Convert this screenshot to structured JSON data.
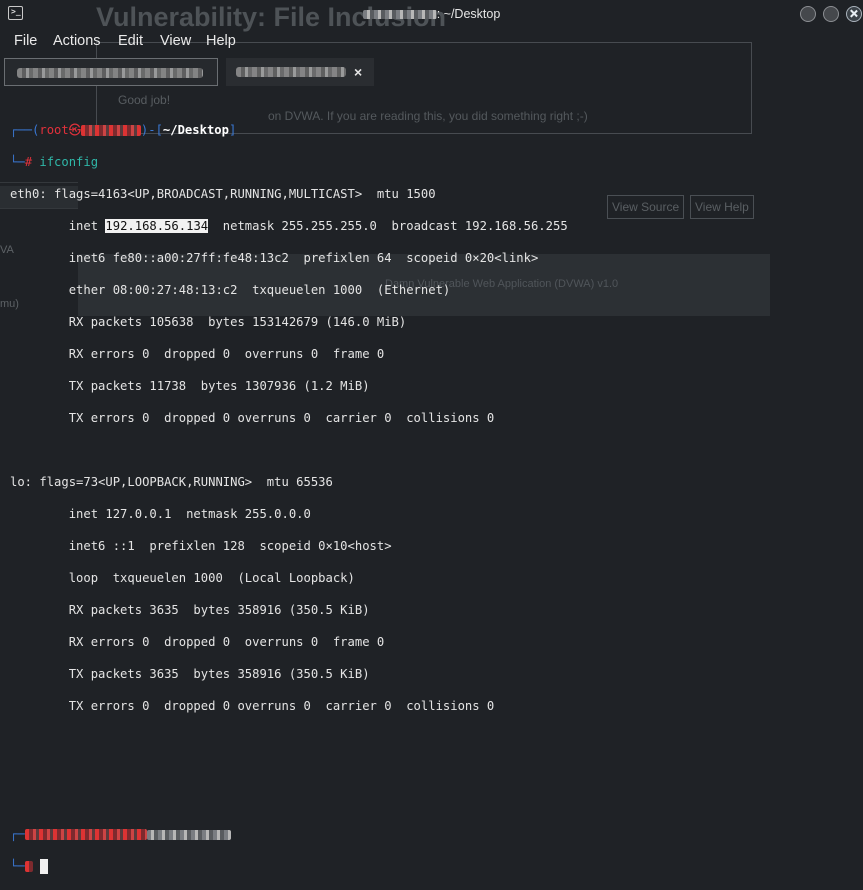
{
  "window": {
    "title": "~/Desktop",
    "title_prefix_redacted": true
  },
  "menu": [
    "File",
    "Actions",
    "Edit",
    "View",
    "Help"
  ],
  "tabs": [
    {
      "label_redacted": true,
      "active": true,
      "close": "x"
    },
    {
      "label_redacted": true,
      "active": false,
      "close": "×"
    }
  ],
  "background_page": {
    "heading": "Vulnerability: File Inclusion",
    "text1": "Good job!",
    "text2": "on DVWA. If you are reading this, you did something right ;-)",
    "buttons": [
      "View Source",
      "View Help"
    ],
    "footer": "Damn Vulnerable Web Application (DVWA) v1.0",
    "side": [
      "VA",
      "mu)"
    ]
  },
  "terminal": {
    "prompt": {
      "user": "root",
      "at": "㉿",
      "dir": "~/Desktop",
      "symbol": "#",
      "command": "ifconfig"
    },
    "eth0": {
      "line1": "eth0: flags=4163<UP,BROADCAST,RUNNING,MULTICAST>  mtu 1500",
      "inet_label": "        inet ",
      "inet_ip": "192.168.56.134",
      "inet_rest": "  netmask 255.255.255.0  broadcast 192.168.56.255",
      "inet6": "        inet6 fe80::a00:27ff:fe48:13c2  prefixlen 64  scopeid 0×20<link>",
      "ether": "        ether 08:00:27:48:13:c2  txqueuelen 1000  (Ethernet)",
      "rx_packets": "        RX packets 105638  bytes 153142679 (146.0 MiB)",
      "rx_errors": "        RX errors 0  dropped 0  overruns 0  frame 0",
      "tx_packets": "        TX packets 11738  bytes 1307936 (1.2 MiB)",
      "tx_errors": "        TX errors 0  dropped 0 overruns 0  carrier 0  collisions 0"
    },
    "lo": {
      "line1": "lo: flags=73<UP,LOOPBACK,RUNNING>  mtu 65536",
      "inet": "        inet 127.0.0.1  netmask 255.0.0.0",
      "inet6": "        inet6 ::1  prefixlen 128  scopeid 0×10<host>",
      "loop": "        loop  txqueuelen 1000  (Local Loopback)",
      "rx_packets": "        RX packets 3635  bytes 358916 (350.5 KiB)",
      "rx_errors": "        RX errors 0  dropped 0  overruns 0  frame 0",
      "tx_packets": "        TX packets 3635  bytes 358916 (350.5 KiB)",
      "tx_errors": "        TX errors 0  dropped 0 overruns 0  carrier 0  collisions 0"
    }
  },
  "colors": {
    "background": "#1f2226",
    "prompt_blue": "#3a78d4",
    "prompt_red": "#e2313b",
    "command": "#2fb7a8",
    "highlight": "#f2f2f2"
  }
}
